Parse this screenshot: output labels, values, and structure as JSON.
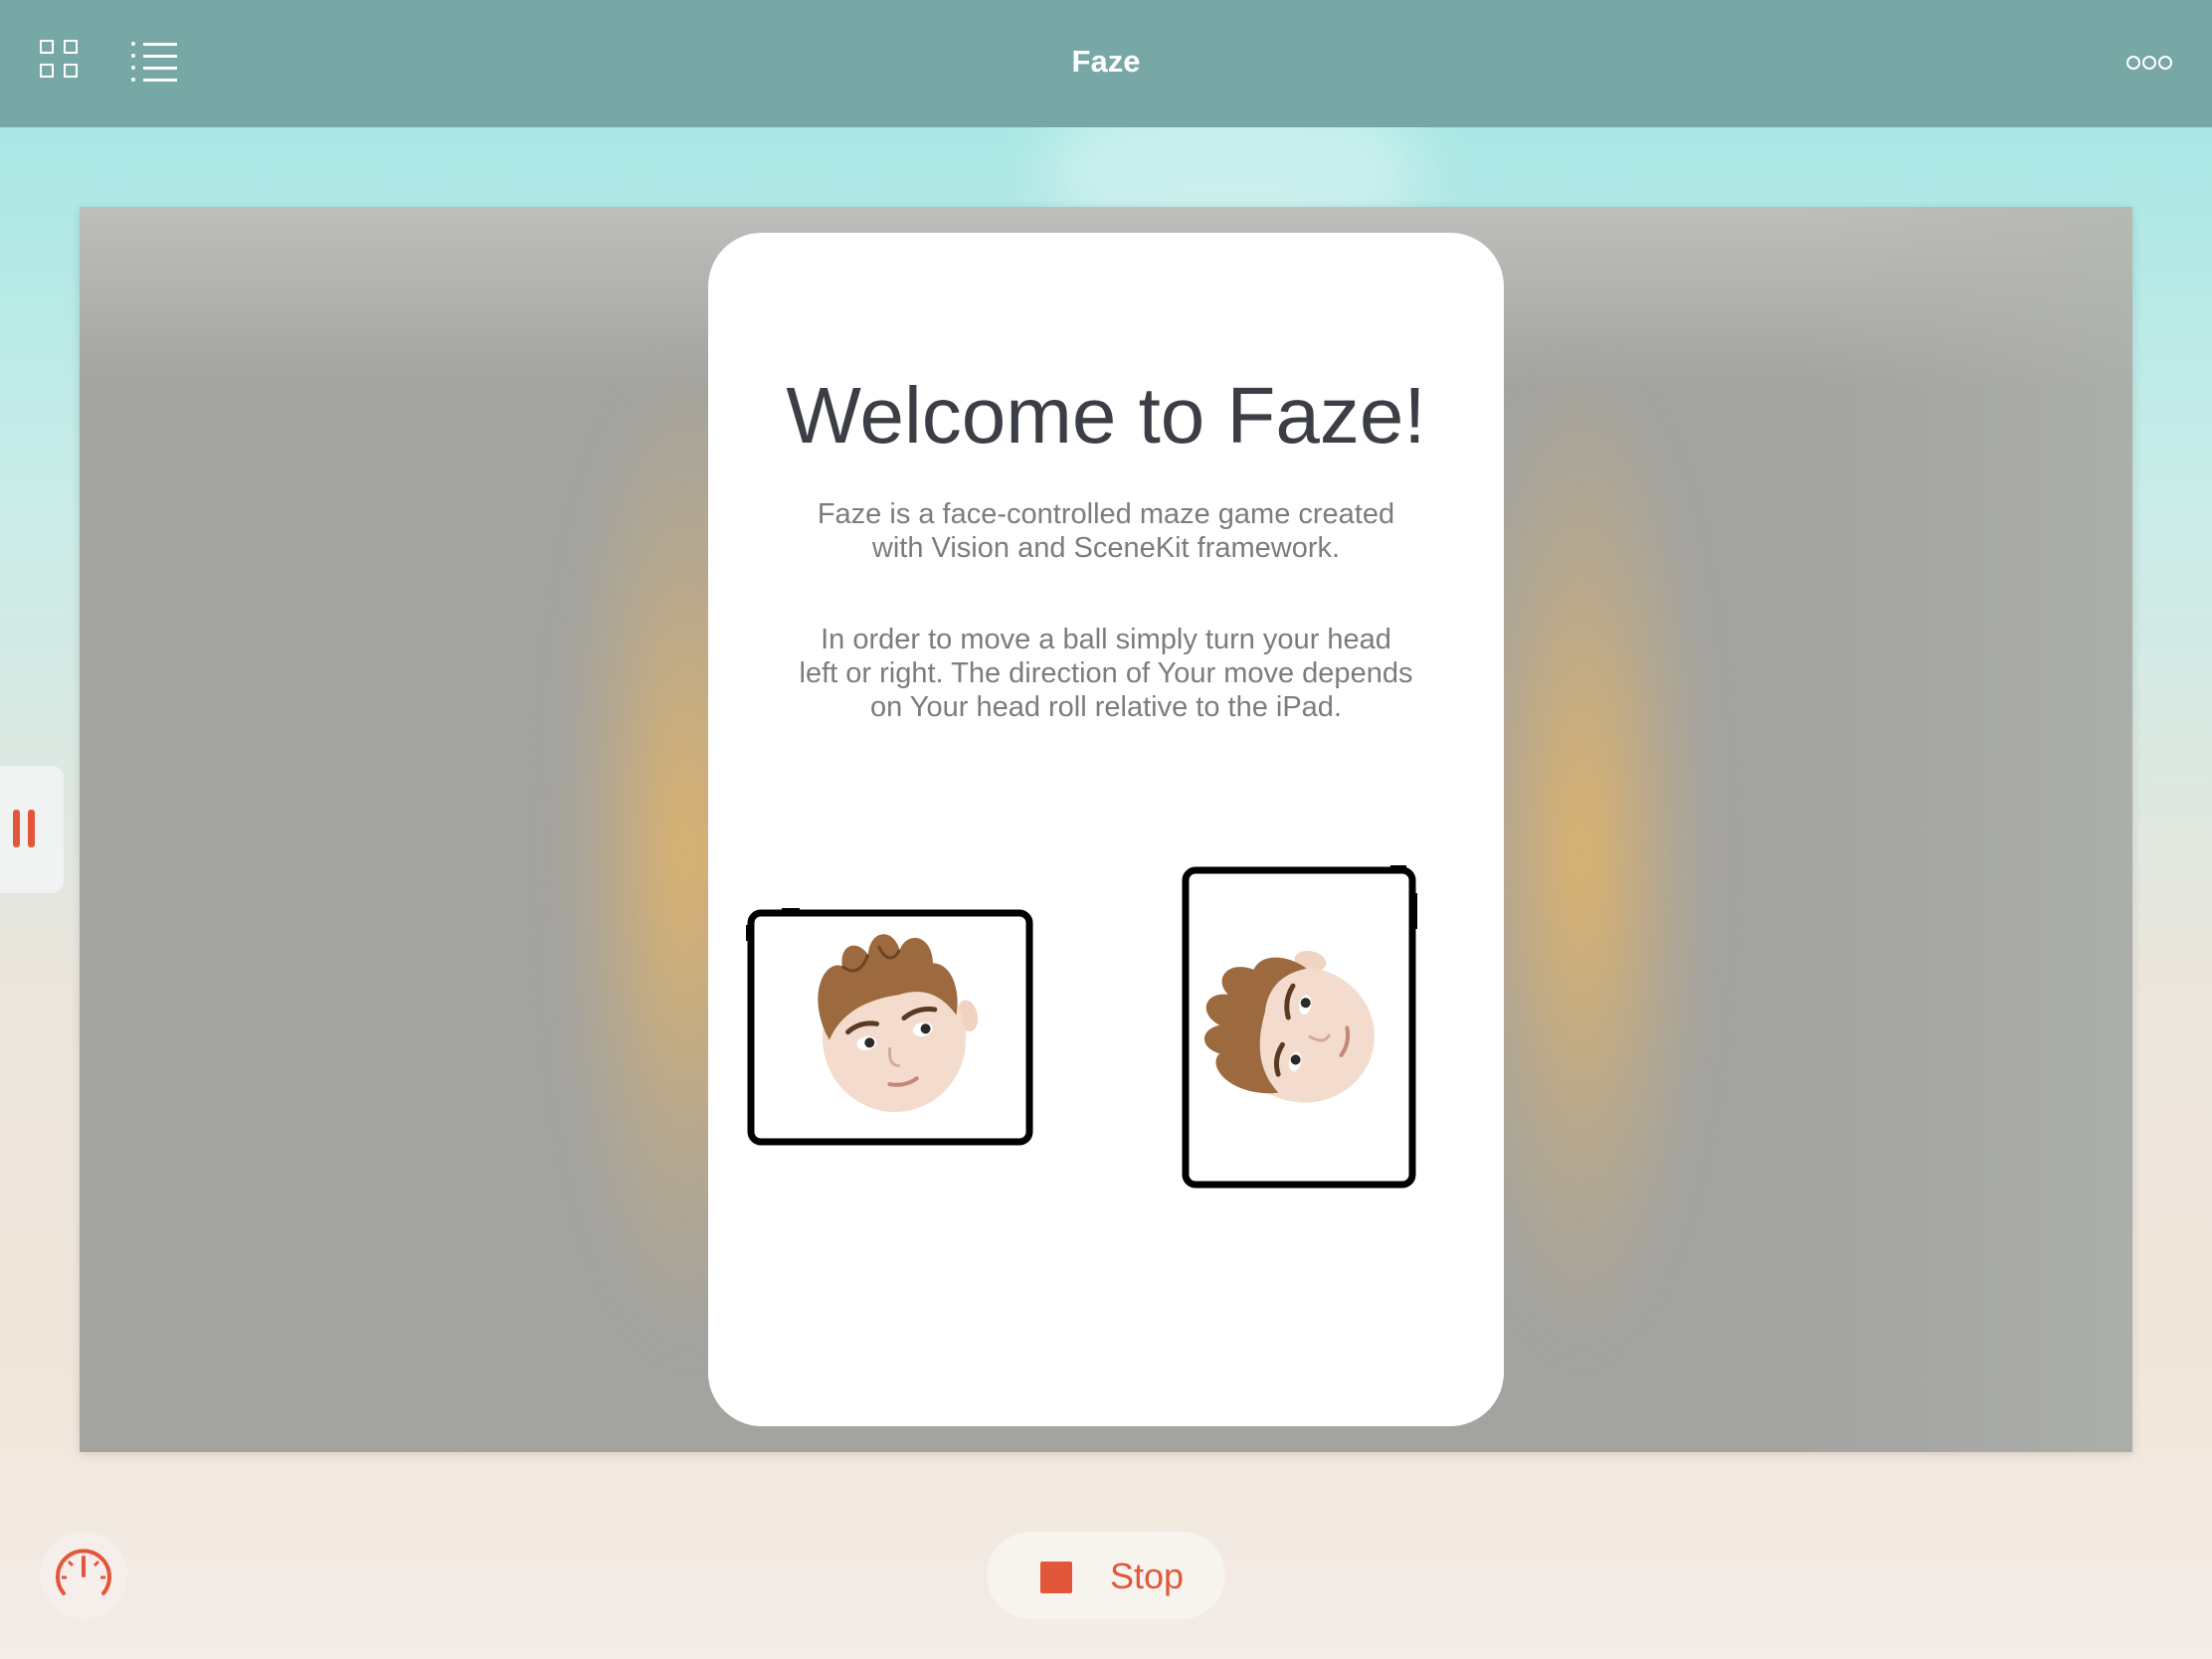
{
  "app": {
    "title": "Faze"
  },
  "toolbar": {
    "grid_icon": "grid-view-icon",
    "list_icon": "list-view-icon",
    "more_icon": "ellipsis-icon"
  },
  "welcome": {
    "heading": "Welcome to Faze!",
    "intro": "Faze is a face-controlled maze game created with Vision and SceneKit framework.",
    "instructions": "In order to move a ball simply turn your head left or right. The direction of Your move depends on Your head roll relative to the iPad."
  },
  "illustrations": {
    "left": "ipad-landscape-memoji-head-tilted",
    "right": "ipad-portrait-memoji-head-rolled"
  },
  "controls": {
    "pause_icon": "pause-icon",
    "gauge_icon": "speedometer-icon",
    "stop_label": "Stop",
    "stop_icon": "stop-square-icon"
  },
  "colors": {
    "topbar": "#78a8a6",
    "accent": "#e2573a",
    "heading_text": "#3c3e45",
    "body_text": "#7c7c80"
  }
}
